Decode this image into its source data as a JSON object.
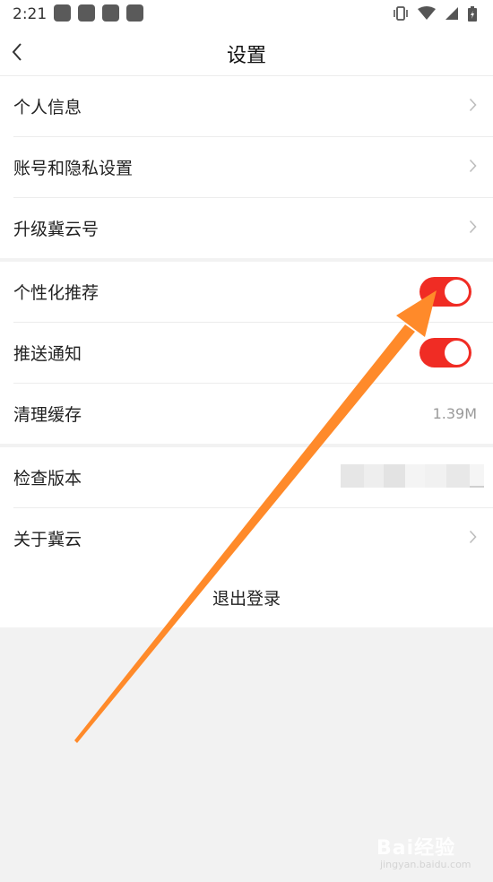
{
  "status_bar": {
    "time": "2:21",
    "notification_icons": [
      "app-icon",
      "app-icon",
      "app-icon",
      "app-icon"
    ],
    "right_icons": [
      "vibrate-icon",
      "wifi-icon",
      "signal-icon",
      "battery-icon"
    ]
  },
  "header": {
    "title": "设置",
    "back_icon": "chevron-left-icon"
  },
  "groups": [
    {
      "items": [
        {
          "label": "个人信息",
          "control": "chevron"
        },
        {
          "label": "账号和隐私设置",
          "control": "chevron"
        },
        {
          "label": "升级冀云号",
          "control": "chevron"
        }
      ]
    },
    {
      "items": [
        {
          "label": "个性化推荐",
          "control": "toggle",
          "on": true
        },
        {
          "label": "推送通知",
          "control": "toggle",
          "on": true
        },
        {
          "label": "清理缓存",
          "control": "value",
          "value": "1.39M"
        }
      ]
    },
    {
      "items": [
        {
          "label": "检查版本",
          "control": "blurred"
        },
        {
          "label": "关于冀云",
          "control": "chevron"
        }
      ]
    }
  ],
  "logout": {
    "label": "退出登录"
  },
  "colors": {
    "toggle_on": "#f02c24",
    "annotation_arrow": "#ff8a2a",
    "background": "#f2f2f2"
  },
  "watermark": {
    "brand": "Bai经验",
    "sub": "jingyan.baidu.com"
  }
}
